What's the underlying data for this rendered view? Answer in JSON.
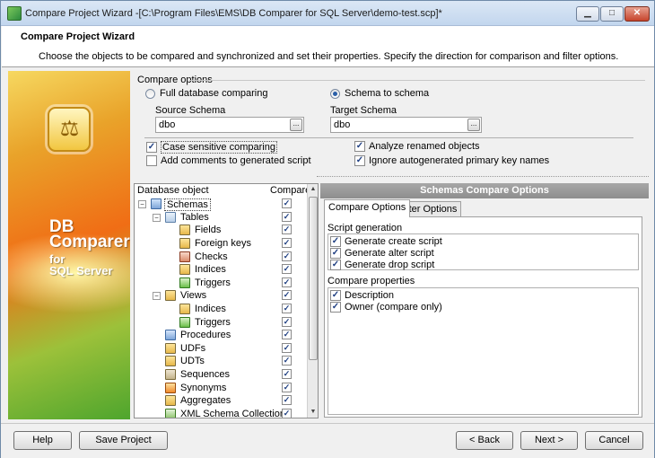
{
  "window": {
    "title": "Compare Project Wizard -[C:\\Program Files\\EMS\\DB Comparer for SQL Server\\demo-test.scp]*",
    "min": "▁",
    "max": "□",
    "close": "✕"
  },
  "header": {
    "title": "Compare Project Wizard",
    "description": "Choose the objects to be compared and synchronized and set their properties. Specify the direction for comparison and filter options."
  },
  "banner": {
    "line1": "DB",
    "line2": "Comparer",
    "line3": "for",
    "line4": "SQL Server"
  },
  "compare_options": {
    "label": "Compare options",
    "radio_full": "Full database comparing",
    "radio_schema": "Schema to schema",
    "source_label": "Source Schema",
    "source_value": "dbo",
    "target_label": "Target Schema",
    "target_value": "dbo",
    "ellipsis": "...",
    "case_sensitive": "Case sensitive comparing",
    "add_comments": "Add comments to generated script",
    "analyze_renamed": "Analyze renamed objects",
    "ignore_pk": "Ignore autogenerated primary key names"
  },
  "tree": {
    "col_object": "Database object",
    "col_compare": "Compare",
    "check": "✓",
    "items": {
      "schemas": "Schemas",
      "tables": "Tables",
      "fields": "Fields",
      "foreign_keys": "Foreign keys",
      "checks": "Checks",
      "indices": "Indices",
      "triggers": "Triggers",
      "views": "Views",
      "view_indices": "Indices",
      "view_triggers": "Triggers",
      "procedures": "Procedures",
      "udfs": "UDFs",
      "udts": "UDTs",
      "sequences": "Sequences",
      "synonyms": "Synonyms",
      "aggregates": "Aggregates",
      "xml_schema": "XML Schema Collection"
    }
  },
  "right_panel": {
    "title": "Schemas Compare Options",
    "tab_compare": "Compare Options",
    "tab_filter": "Filter Options",
    "script_generation": "Script generation",
    "gen_create": "Generate create script",
    "gen_alter": "Generate alter script",
    "gen_drop": "Generate drop script",
    "compare_properties": "Compare properties",
    "prop_description": "Description",
    "prop_owner": "Owner (compare only)"
  },
  "footer": {
    "help": "Help",
    "save_project": "Save Project",
    "back": "< Back",
    "next": "Next >",
    "cancel": "Cancel"
  }
}
